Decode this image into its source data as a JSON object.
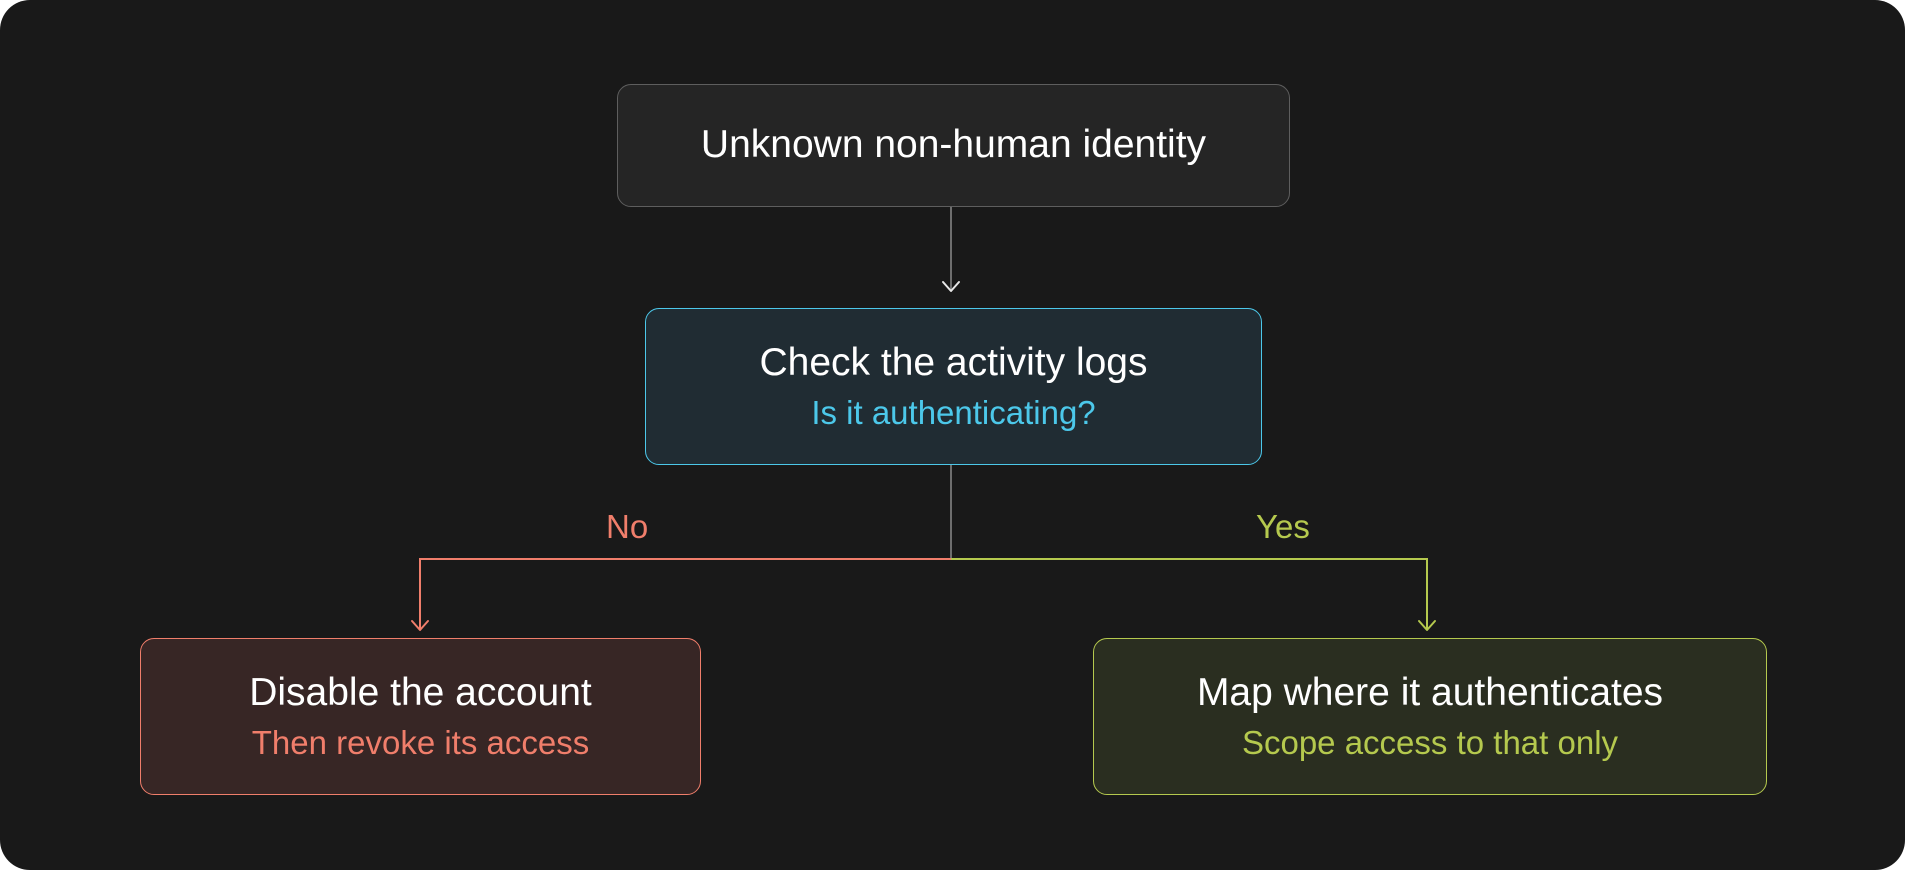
{
  "nodes": {
    "start": {
      "title": "Unknown non-human identity"
    },
    "check": {
      "title": "Check the activity logs",
      "subtitle": "Is it authenticating?"
    },
    "disable": {
      "title": "Disable the account",
      "subtitle": "Then revoke its access"
    },
    "map": {
      "title": "Map where it authenticates",
      "subtitle": "Scope access to that only"
    }
  },
  "branches": {
    "no": "No",
    "yes": "Yes"
  },
  "colors": {
    "background": "#191919",
    "neutral": "#6e6e6e",
    "check_accent": "#4cc8ea",
    "no_accent": "#f07e6b",
    "yes_accent": "#b5c94e"
  }
}
